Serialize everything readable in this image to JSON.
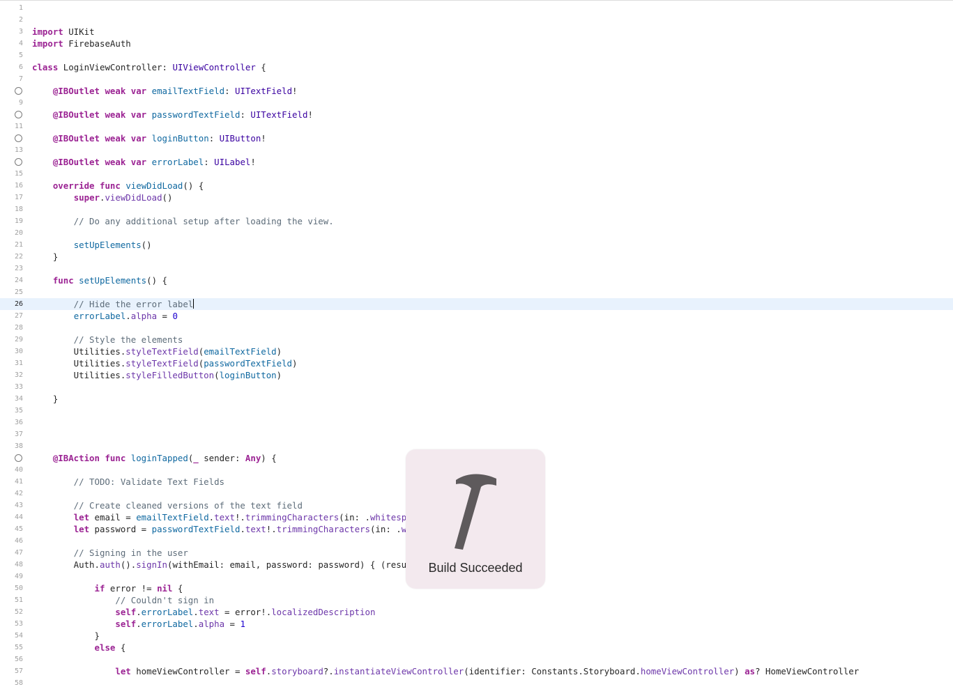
{
  "editor": {
    "current_line": 26,
    "breakpoint_lines": [
      8,
      10,
      12,
      14,
      39
    ],
    "lines": [
      [],
      [],
      [
        [
          "import",
          "kw"
        ],
        [
          " UIKit",
          ""
        ]
      ],
      [
        [
          "import",
          "kw"
        ],
        [
          " FirebaseAuth",
          ""
        ]
      ],
      [],
      [
        [
          "class",
          "kw"
        ],
        [
          " LoginViewController: ",
          ""
        ],
        [
          "UIViewController",
          "ty"
        ],
        [
          " {",
          ""
        ]
      ],
      [],
      [
        [
          "    ",
          ""
        ],
        [
          "@IBOutlet",
          "kw"
        ],
        [
          " ",
          ""
        ],
        [
          "weak",
          "kw"
        ],
        [
          " ",
          ""
        ],
        [
          "var",
          "kw"
        ],
        [
          " ",
          ""
        ],
        [
          "emailTextField",
          "pr"
        ],
        [
          ": ",
          ""
        ],
        [
          "UITextField",
          "ty"
        ],
        [
          "!",
          ""
        ]
      ],
      [],
      [
        [
          "    ",
          ""
        ],
        [
          "@IBOutlet",
          "kw"
        ],
        [
          " ",
          ""
        ],
        [
          "weak",
          "kw"
        ],
        [
          " ",
          ""
        ],
        [
          "var",
          "kw"
        ],
        [
          " ",
          ""
        ],
        [
          "passwordTextField",
          "pr"
        ],
        [
          ": ",
          ""
        ],
        [
          "UITextField",
          "ty"
        ],
        [
          "!",
          ""
        ]
      ],
      [],
      [
        [
          "    ",
          ""
        ],
        [
          "@IBOutlet",
          "kw"
        ],
        [
          " ",
          ""
        ],
        [
          "weak",
          "kw"
        ],
        [
          " ",
          ""
        ],
        [
          "var",
          "kw"
        ],
        [
          " ",
          ""
        ],
        [
          "loginButton",
          "pr"
        ],
        [
          ": ",
          ""
        ],
        [
          "UIButton",
          "ty"
        ],
        [
          "!",
          ""
        ]
      ],
      [],
      [
        [
          "    ",
          ""
        ],
        [
          "@IBOutlet",
          "kw"
        ],
        [
          " ",
          ""
        ],
        [
          "weak",
          "kw"
        ],
        [
          " ",
          ""
        ],
        [
          "var",
          "kw"
        ],
        [
          " ",
          ""
        ],
        [
          "errorLabel",
          "pr"
        ],
        [
          ": ",
          ""
        ],
        [
          "UILabel",
          "ty"
        ],
        [
          "!",
          ""
        ]
      ],
      [],
      [
        [
          "    ",
          ""
        ],
        [
          "override",
          "kw"
        ],
        [
          " ",
          ""
        ],
        [
          "func",
          "kw"
        ],
        [
          " ",
          ""
        ],
        [
          "viewDidLoad",
          "pr"
        ],
        [
          "() {",
          ""
        ]
      ],
      [
        [
          "        ",
          ""
        ],
        [
          "super",
          "kw"
        ],
        [
          ".",
          ""
        ],
        [
          "viewDidLoad",
          "fn"
        ],
        [
          "()",
          ""
        ]
      ],
      [],
      [
        [
          "        // Do any additional setup after loading the view.",
          "cm"
        ]
      ],
      [],
      [
        [
          "        ",
          ""
        ],
        [
          "setUpElements",
          "pr"
        ],
        [
          "()",
          ""
        ]
      ],
      [
        [
          "    }",
          ""
        ]
      ],
      [],
      [
        [
          "    ",
          ""
        ],
        [
          "func",
          "kw"
        ],
        [
          " ",
          ""
        ],
        [
          "setUpElements",
          "pr"
        ],
        [
          "() {",
          ""
        ]
      ],
      [],
      [
        [
          "        // Hide the error label",
          "cm"
        ]
      ],
      [
        [
          "        ",
          ""
        ],
        [
          "errorLabel",
          "pr"
        ],
        [
          ".",
          ""
        ],
        [
          "alpha",
          "fn"
        ],
        [
          " = ",
          ""
        ],
        [
          "0",
          "nu"
        ]
      ],
      [],
      [
        [
          "        // Style the elements",
          "cm"
        ]
      ],
      [
        [
          "        Utilities.",
          ""
        ],
        [
          "styleTextField",
          "fn"
        ],
        [
          "(",
          ""
        ],
        [
          "emailTextField",
          "pr"
        ],
        [
          ")",
          ""
        ]
      ],
      [
        [
          "        Utilities.",
          ""
        ],
        [
          "styleTextField",
          "fn"
        ],
        [
          "(",
          ""
        ],
        [
          "passwordTextField",
          "pr"
        ],
        [
          ")",
          ""
        ]
      ],
      [
        [
          "        Utilities.",
          ""
        ],
        [
          "styleFilledButton",
          "fn"
        ],
        [
          "(",
          ""
        ],
        [
          "loginButton",
          "pr"
        ],
        [
          ")",
          ""
        ]
      ],
      [],
      [
        [
          "    }",
          ""
        ]
      ],
      [],
      [],
      [],
      [],
      [
        [
          "    ",
          ""
        ],
        [
          "@IBAction",
          "kw"
        ],
        [
          " ",
          ""
        ],
        [
          "func",
          "kw"
        ],
        [
          " ",
          ""
        ],
        [
          "loginTapped",
          "pr"
        ],
        [
          "(",
          ""
        ],
        [
          "_",
          "kw"
        ],
        [
          " sender: ",
          ""
        ],
        [
          "Any",
          "kw"
        ],
        [
          ") {",
          ""
        ]
      ],
      [],
      [
        [
          "        // TODO: Validate Text Fields",
          "cm"
        ]
      ],
      [],
      [
        [
          "        // Create cleaned versions of the text field",
          "cm"
        ]
      ],
      [
        [
          "        ",
          ""
        ],
        [
          "let",
          "kw"
        ],
        [
          " email = ",
          ""
        ],
        [
          "emailTextField",
          "pr"
        ],
        [
          ".",
          ""
        ],
        [
          "text",
          "fn"
        ],
        [
          "!.",
          ""
        ],
        [
          "trimmingCharacters",
          "fn"
        ],
        [
          "(in: .",
          ""
        ],
        [
          "whitespa",
          "fn"
        ]
      ],
      [
        [
          "        ",
          ""
        ],
        [
          "let",
          "kw"
        ],
        [
          " password = ",
          ""
        ],
        [
          "passwordTextField",
          "pr"
        ],
        [
          ".",
          ""
        ],
        [
          "text",
          "fn"
        ],
        [
          "!.",
          ""
        ],
        [
          "trimmingCharacters",
          "fn"
        ],
        [
          "(in: .",
          ""
        ],
        [
          "wh",
          "fn"
        ]
      ],
      [],
      [
        [
          "        // Signing in the user",
          "cm"
        ]
      ],
      [
        [
          "        Auth.",
          ""
        ],
        [
          "auth",
          "fn"
        ],
        [
          "().",
          ""
        ],
        [
          "signIn",
          "fn"
        ],
        [
          "(withEmail: email, password: password) { (resul",
          ""
        ]
      ],
      [],
      [
        [
          "            ",
          ""
        ],
        [
          "if",
          "kw"
        ],
        [
          " error != ",
          ""
        ],
        [
          "nil",
          "kw"
        ],
        [
          " {",
          ""
        ]
      ],
      [
        [
          "                // Couldn't sign in",
          "cm"
        ]
      ],
      [
        [
          "                ",
          ""
        ],
        [
          "self",
          "kw"
        ],
        [
          ".",
          ""
        ],
        [
          "errorLabel",
          "pr"
        ],
        [
          ".",
          ""
        ],
        [
          "text",
          "fn"
        ],
        [
          " = error!.",
          ""
        ],
        [
          "localizedDescription",
          "fn"
        ]
      ],
      [
        [
          "                ",
          ""
        ],
        [
          "self",
          "kw"
        ],
        [
          ".",
          ""
        ],
        [
          "errorLabel",
          "pr"
        ],
        [
          ".",
          ""
        ],
        [
          "alpha",
          "fn"
        ],
        [
          " = ",
          ""
        ],
        [
          "1",
          "nu"
        ]
      ],
      [
        [
          "            }",
          ""
        ]
      ],
      [
        [
          "            ",
          ""
        ],
        [
          "else",
          "kw"
        ],
        [
          " {",
          ""
        ]
      ],
      [],
      [
        [
          "                ",
          ""
        ],
        [
          "let",
          "kw"
        ],
        [
          " homeViewController = ",
          ""
        ],
        [
          "self",
          "kw"
        ],
        [
          ".",
          ""
        ],
        [
          "storyboard",
          "fn"
        ],
        [
          "?.",
          ""
        ],
        [
          "instantiateViewController",
          "fn"
        ],
        [
          "(identifier: Constants.Storyboard.",
          ""
        ],
        [
          "homeViewController",
          "fn"
        ],
        [
          ") ",
          ""
        ],
        [
          "as",
          "kw"
        ],
        [
          "? HomeViewController",
          ""
        ]
      ],
      []
    ]
  },
  "hud": {
    "icon": "hammer-icon",
    "label": "Build Succeeded"
  }
}
